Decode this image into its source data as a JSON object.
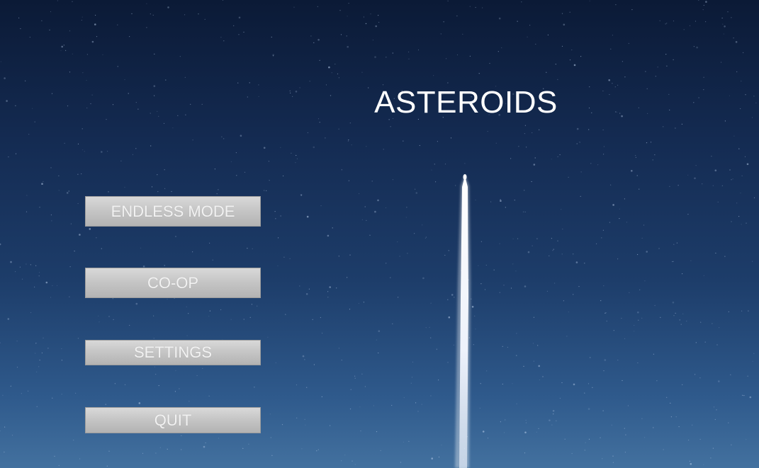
{
  "title": "ASTEROIDS",
  "menu": {
    "endless_label": "ENDLESS MODE",
    "coop_label": "CO-OP",
    "settings_label": "SETTINGS",
    "quit_label": "QUIT"
  },
  "colors": {
    "background_top": "#0b1a36",
    "background_bottom": "#43719f",
    "button_face": "#c6c6c6",
    "button_text": "#f2f2f2",
    "title_text": "#ffffff",
    "trail": "#ffffff"
  }
}
